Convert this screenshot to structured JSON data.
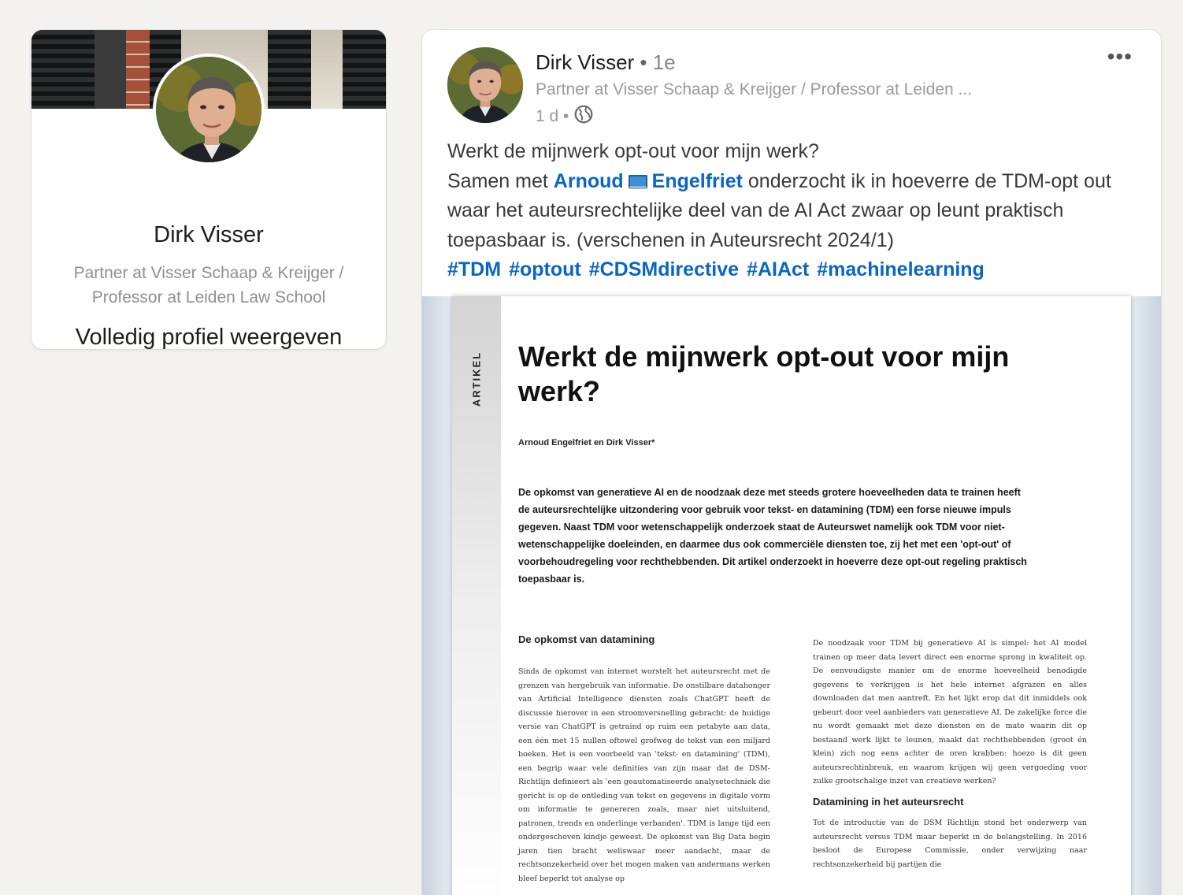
{
  "profile": {
    "name": "Dirk Visser",
    "headline_line1": "Partner at Visser Schaap & Kreijger /",
    "headline_line2": "Professor at Leiden Law School",
    "view_profile_label": "Volledig profiel weergeven"
  },
  "post": {
    "author_name": "Dirk Visser",
    "separator": " • ",
    "degree": "1e",
    "author_headline": "Partner at Visser Schaap & Kreijger / Professor at Leiden ...",
    "time": "1 d •",
    "time_icon": "globe-icon",
    "more_icon": "ellipsis-icon",
    "more_label": "•••",
    "text": {
      "line1": "Werkt de mijnwerk opt-out voor mijn werk?",
      "line2_before": "Samen met ",
      "mention_first": "Arnoud",
      "mention_emoji": "laptop-icon",
      "mention_last": "Engelfriet",
      "line2_after": " onderzocht ik in hoeverre de TDM-opt out waar het auteursrechtelijke deel van de AI Act zwaar op leunt praktisch toepasbaar is. (verschenen in Auteursrecht 2024/1)"
    },
    "hashtags": [
      "#TDM",
      "#optout",
      "#CDSMdirective",
      "#AIAct",
      "#machinelearning"
    ]
  },
  "document": {
    "side_label": "ARTIKEL",
    "title": "Werkt de mijnwerk opt-out voor mijn werk?",
    "authors": "Arnoud Engelfriet en Dirk Visser*",
    "abstract": "De opkomst van generatieve AI en de noodzaak deze met steeds grotere hoeveelheden data te trainen heeft de auteursrechtelijke uitzondering voor gebruik voor tekst- en datamining (TDM) een forse nieuwe impuls gegeven. Naast TDM voor wetenschappelijk onderzoek staat de Auteurswet namelijk ook TDM voor niet-wetenschappelijke doeleinden, en daarmee dus ook commerciële diensten toe, zij het met een 'opt-out' of voorbehoudregeling voor rechthebbenden. Dit artikel onderzoekt in hoeverre deze opt-out regeling praktisch toepasbaar is.",
    "left_heading": "De opkomst van datamining",
    "left_body": "Sinds de opkomst van internet worstelt het auteursrecht met de grenzen van hergebruik van informatie. De onstilbare datahonger van Artificial Intelligence diensten zoals ChatGPT heeft de discussie hierover in een stroomversnelling gebracht: de huidige versie van ChatGPT is getraind op ruim een petabyte aan data, een één met 15 nullen oftewel grofweg de tekst van een miljard boeken. Het is een voorbeeld van 'tekst- en datamining' (TDM), een begrip waar vele definities van zijn maar dat de DSM-Richtlijn definieert als 'een geautomatiseerde analysetechniek die gericht is op de ontleding van tekst en gegevens in digitale vorm om informatie te genereren zoals, maar niet uitsluitend, patronen, trends en onderlinge verbanden'. TDM is lange tijd een ondergeschoven kindje geweest. De opkomst van Big Data begin jaren tien bracht weliswaar meer aandacht, maar de rechtsonzekerheid over het mogen maken van andermans werken bleef beperkt tot analyse op",
    "right_body": "De noodzaak voor TDM bij generatieve AI is simpel: het AI model trainen op meer data levert direct een enorme sprong in kwaliteit op. De eenvoudigste manier om de enorme hoeveelheid benodigde gegevens te verkrijgen is het hele internet afgrazen en alles downloaden dat men aantreft. En het lijkt erop dat dit inmiddels ook gebeurt door veel aanbieders van generatieve AI. De zakelijke force die nu wordt gemaakt met deze diensten en de mate waarin dit op bestaand werk lijkt te leunen, maakt dat rechthebbenden (groot én klein) zich nog eens achter de oren krabben: hoezo is dit geen auteursrechtinbreuk, en waarom krijgen wij geen vergoeding voor zulke grootschalige inzet van creatieve werken?",
    "right_heading": "Datamining in het auteursrecht",
    "right_body2": "Tot de introductie van de DSM Richtlijn stond het onderwerp van auteursrecht versus TDM maar beperkt in de belangstelling. In 2016 besloot de Europese Commissie, onder verwijzing naar rechtsonzekerheid bij partijen die"
  }
}
